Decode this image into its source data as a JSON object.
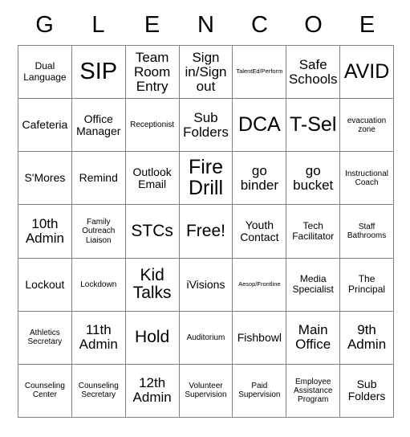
{
  "card": {
    "title_letters": [
      "G",
      "L",
      "E",
      "N",
      "C",
      "O",
      "E"
    ],
    "columns": 7,
    "rows": 7,
    "grid_line_color": "#808080",
    "background_color": "#ffffff",
    "text_color": "#000000",
    "free_space_label": "Free!",
    "cells": [
      [
        {
          "text": "Dual Language",
          "size": "s"
        },
        {
          "text": "SIP",
          "size": "xxxl"
        },
        {
          "text": "Team Room Entry",
          "size": "l"
        },
        {
          "text": "Sign in/Sign out",
          "size": "l"
        },
        {
          "text": "TalentEd/Perform",
          "size": "xxs"
        },
        {
          "text": "Safe Schools",
          "size": "l"
        },
        {
          "text": "AVID",
          "size": "xxl"
        }
      ],
      [
        {
          "text": "Cafeteria",
          "size": "m"
        },
        {
          "text": "Office Manager",
          "size": "m"
        },
        {
          "text": "Receptionist",
          "size": "xs"
        },
        {
          "text": "Sub Folders",
          "size": "l"
        },
        {
          "text": "DCA",
          "size": "xxl"
        },
        {
          "text": "T-Sel",
          "size": "xxl"
        },
        {
          "text": "evacuation zone",
          "size": "xs"
        }
      ],
      [
        {
          "text": "S'Mores",
          "size": "m"
        },
        {
          "text": "Remind",
          "size": "m"
        },
        {
          "text": "Outlook Email",
          "size": "m"
        },
        {
          "text": "Fire Drill",
          "size": "xxl"
        },
        {
          "text": "go binder",
          "size": "l"
        },
        {
          "text": "go bucket",
          "size": "l"
        },
        {
          "text": "Instructional Coach",
          "size": "xs"
        }
      ],
      [
        {
          "text": "10th Admin",
          "size": "l"
        },
        {
          "text": "Family Outreach Liaison",
          "size": "xs"
        },
        {
          "text": "STCs",
          "size": "xl"
        },
        {
          "text": "Free!",
          "size": "xl"
        },
        {
          "text": "Youth Contact",
          "size": "m"
        },
        {
          "text": "Tech Facilitator",
          "size": "s"
        },
        {
          "text": "Staff Bathrooms",
          "size": "xs"
        }
      ],
      [
        {
          "text": "Lockout",
          "size": "m"
        },
        {
          "text": "Lockdown",
          "size": "xs"
        },
        {
          "text": "Kid Talks",
          "size": "xl"
        },
        {
          "text": "iVisions",
          "size": "m"
        },
        {
          "text": "Aesop/Frontline",
          "size": "xxs"
        },
        {
          "text": "Media Specialist",
          "size": "s"
        },
        {
          "text": "The Principal",
          "size": "s"
        }
      ],
      [
        {
          "text": "Athletics Secretary",
          "size": "xs"
        },
        {
          "text": "11th Admin",
          "size": "l"
        },
        {
          "text": "Hold",
          "size": "xl"
        },
        {
          "text": "Auditorium",
          "size": "xs"
        },
        {
          "text": "Fishbowl",
          "size": "m"
        },
        {
          "text": "Main Office",
          "size": "l"
        },
        {
          "text": "9th Admin",
          "size": "l"
        }
      ],
      [
        {
          "text": "Counseling Center",
          "size": "xs"
        },
        {
          "text": "Counseling Secretary",
          "size": "xs"
        },
        {
          "text": "12th Admin",
          "size": "l"
        },
        {
          "text": "Volunteer Supervision",
          "size": "xs"
        },
        {
          "text": "Paid Supervision",
          "size": "xs"
        },
        {
          "text": "Employee Assistance Program",
          "size": "xs"
        },
        {
          "text": "Sub Folders",
          "size": "m"
        }
      ]
    ]
  }
}
